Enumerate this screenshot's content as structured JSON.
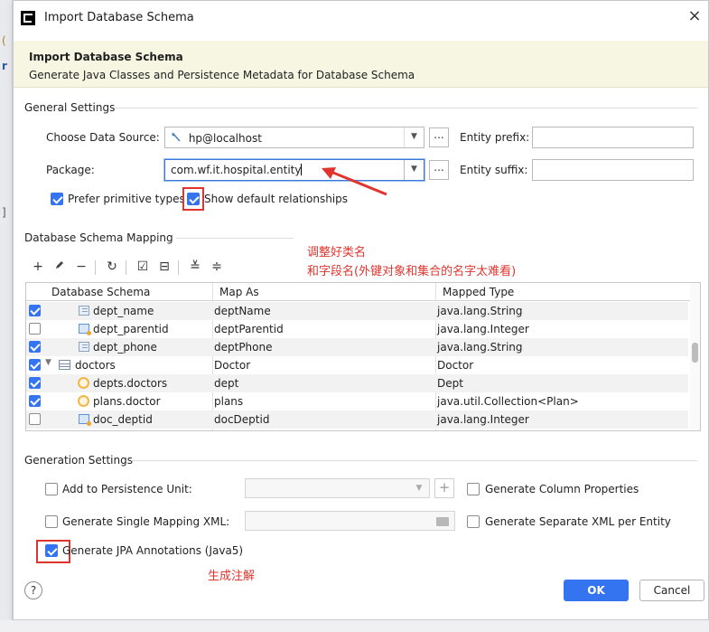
{
  "window": {
    "title": "Import Database Schema",
    "close_glyph": "×"
  },
  "banner": {
    "title": "Import Database Schema",
    "subtitle": "Generate Java Classes and Persistence Metadata for Database Schema"
  },
  "general": {
    "heading": "General Settings",
    "data_source_label": "Choose Data Source:",
    "data_source_value": "hp@localhost",
    "package_label": "Package:",
    "package_value": "com.wf.it.hospital.entity",
    "entity_prefix_label": "Entity prefix:",
    "entity_prefix_value": "",
    "entity_suffix_label": "Entity suffix:",
    "entity_suffix_value": "",
    "dots_label": "...",
    "prefer_primitive_label": "Prefer primitive types",
    "prefer_primitive_checked": true,
    "show_default_rel_label": "Show default relationships",
    "show_default_rel_checked": true
  },
  "mapping": {
    "heading": "Database Schema Mapping",
    "columns": [
      "Database Schema",
      "Map As",
      "Mapped Type"
    ],
    "rows": [
      {
        "checked": true,
        "icon": "column-icon",
        "schema": "dept_name",
        "map_as": "deptName",
        "type": "java.lang.String"
      },
      {
        "checked": false,
        "icon": "fk-column-icon",
        "schema": "dept_parentid",
        "map_as": "deptParentid",
        "type": "java.lang.Integer"
      },
      {
        "checked": true,
        "icon": "column-icon",
        "schema": "dept_phone",
        "map_as": "deptPhone",
        "type": "java.lang.String"
      },
      {
        "checked": true,
        "icon": "table-icon",
        "schema": "doctors",
        "map_as": "Doctor",
        "type": "Doctor"
      },
      {
        "checked": true,
        "icon": "relationship-icon",
        "schema": "depts.doctors",
        "map_as": "dept",
        "type": "Dept"
      },
      {
        "checked": true,
        "icon": "relationship-icon",
        "schema": "plans.doctor",
        "map_as": "plans",
        "type": "java.util.Collection<Plan>"
      },
      {
        "checked": false,
        "icon": "fk-column-icon",
        "schema": "doc_deptid",
        "map_as": "docDeptid",
        "type": "java.lang.Integer"
      }
    ]
  },
  "generation": {
    "heading": "Generation Settings",
    "add_persistence_label": "Add to Persistence Unit:",
    "single_mapping_label": "Generate Single Mapping XML:",
    "jpa_annotations_label": "Generate JPA Annotations (Java5)",
    "jpa_annotations_checked": true,
    "column_props_label": "Generate Column Properties",
    "separate_xml_label": "Generate Separate XML per Entity"
  },
  "annotations": {
    "note_line1": "调整好类名",
    "note_line2": "和字段名(外键对象和集合的名字太难看)",
    "note_jpa": "生成注解",
    "red_color": "#e0352f"
  },
  "buttons": {
    "help": "?",
    "ok": "OK",
    "cancel": "Cancel"
  }
}
